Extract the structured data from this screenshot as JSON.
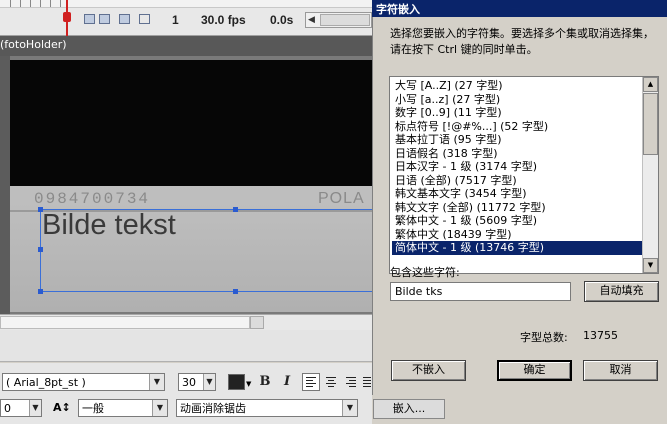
{
  "timeline": {
    "frame_number": "1",
    "fps": "30.0 fps",
    "time": "0.0s"
  },
  "document": {
    "tab_label": "(fotoHolder)"
  },
  "stage": {
    "photo_number": "0984700734",
    "photo_brand": "POLA",
    "text_content": "Bilde tekst"
  },
  "properties": {
    "font_name": "( Arial_8pt_st )",
    "font_size": "30",
    "bold_label": "B",
    "italic_label": "I",
    "letter_spacing": "0",
    "spacing_icon_label": "A↕",
    "rendering_mode": "一般",
    "antialias": "动画消除锯齿",
    "embed_button": "嵌入..."
  },
  "dialog": {
    "title": "字符嵌入",
    "instruction": "选择您要嵌入的字符集。要选择多个集或取消选择集，请在按下 Ctrl 键的同时单击。",
    "charsets": [
      "大写 [A..Z]  (27 字型)",
      "小写 [a..z]  (27 字型)",
      "数字 [0..9]  (11 字型)",
      "标点符号 [!@#%...]  (52 字型)",
      "基本拉丁语  (95 字型)",
      "日语假名  (318 字型)",
      "日本汉字 - 1 级  (3174 字型)",
      "日语 (全部)  (7517 字型)",
      "韩文基本文字  (3454 字型)",
      "韩文文字 (全部)  (11772 字型)",
      "繁体中文 - 1 级  (5609 字型)",
      "繁体中文  (18439 字型)",
      "简体中文 - 1 级  (13746 字型)"
    ],
    "selected_index": 12,
    "include_label": "包含这些字符:",
    "include_value": "Bilde tks",
    "autofill_button": "自动填充",
    "total_label": "字型总数:",
    "total_value": "13755",
    "no_embed_button": "不嵌入",
    "ok_button": "确定",
    "cancel_button": "取消"
  }
}
